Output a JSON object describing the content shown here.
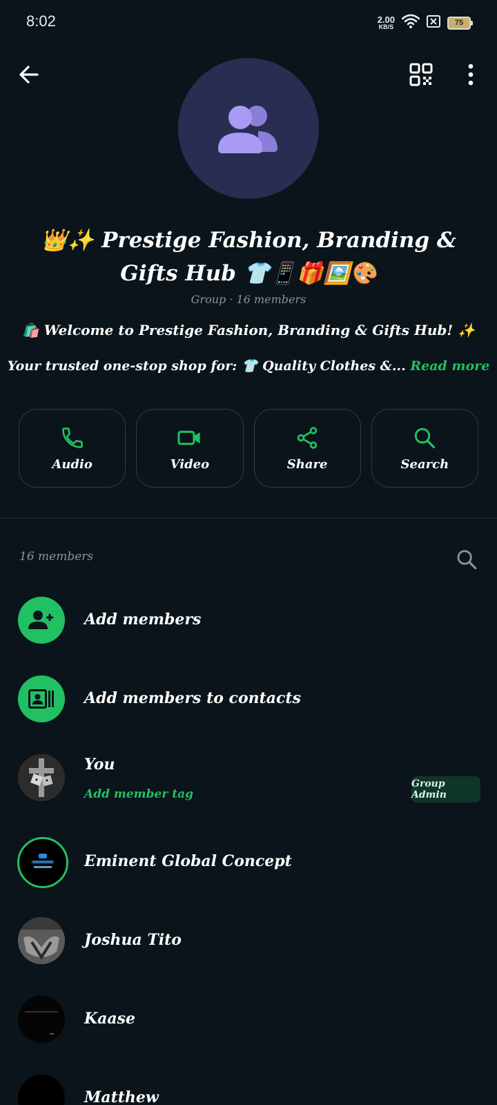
{
  "status_bar": {
    "time": "8:02",
    "net_speed_value": "2.00",
    "net_speed_unit": "KB/S",
    "battery_level": "75"
  },
  "header": {
    "back_icon": "arrow-left-icon",
    "qr_icon": "qr-code-icon",
    "more_icon": "more-vertical-icon"
  },
  "group": {
    "avatar_icon": "group-people-icon",
    "avatar_color": "#2a2d52",
    "icon_color": "#a89af5",
    "title": "👑✨ Prestige Fashion, Branding & Gifts Hub 👕📱🎁🖼️🎨",
    "subtitle": "Group · 16 members",
    "description_line1": "🛍️ Welcome to Prestige Fashion, Branding & Gifts Hub! ✨",
    "description_line2": "Your trusted one-stop shop for: 👕 Quality Clothes &...",
    "read_more": "Read more"
  },
  "actions": [
    {
      "label": "Audio",
      "icon": "phone-icon"
    },
    {
      "label": "Video",
      "icon": "video-icon"
    },
    {
      "label": "Share",
      "icon": "share-icon"
    },
    {
      "label": "Search",
      "icon": "search-icon"
    }
  ],
  "members_section": {
    "count_label": "16 members",
    "search_icon": "search-icon",
    "add_members": "Add members",
    "add_members_to_contacts": "Add members to contacts",
    "members": [
      {
        "name": "You",
        "tag": "Add member tag",
        "badge": "Group Admin"
      },
      {
        "name": "Eminent Global Concept"
      },
      {
        "name": "Joshua Tito"
      },
      {
        "name": "Kaase"
      },
      {
        "name": "Matthew"
      }
    ]
  },
  "colors": {
    "background": "#0b141a",
    "accent": "#21c063",
    "muted": "#8696a0"
  }
}
